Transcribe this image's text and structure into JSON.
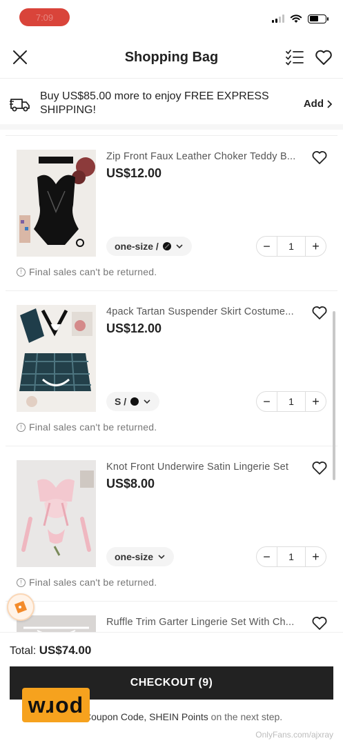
{
  "status_bar": {
    "recording_label": "7:09",
    "battery_level": 0.55
  },
  "header": {
    "title": "Shopping Bag"
  },
  "shipping": {
    "text": "Buy US$85.00 more to enjoy FREE EXPRESS SHIPPING!",
    "action": "Add"
  },
  "items": [
    {
      "title": "Zip Front Faux Leather Choker Teddy B...",
      "price": "US$12.00",
      "variant": "one-size /",
      "variant_swatch": true,
      "qty": "1",
      "note": "Final sales can't be returned."
    },
    {
      "title": "4pack Tartan Suspender Skirt Costume...",
      "price": "US$12.00",
      "variant": "S /",
      "variant_swatch": true,
      "qty": "1",
      "note": "Final sales can't be returned."
    },
    {
      "title": "Knot Front Underwire Satin Lingerie Set",
      "price": "US$8.00",
      "variant": "one-size",
      "variant_swatch": false,
      "qty": "1",
      "note": "Final sales can't be returned."
    },
    {
      "title": "Ruffle Trim Garter Lingerie Set With Ch...",
      "price": "",
      "variant": "",
      "variant_swatch": false,
      "qty": "",
      "note": ""
    }
  ],
  "footer": {
    "total_label": "Total:",
    "total_amount": "US$74.00",
    "checkout_label": "CHECKOUT (9)",
    "hint_prefix": "Coupon Code, SHEIN Points",
    "hint_suffix": " on the next step."
  },
  "overlay": {
    "logo_text": "wɹod",
    "watermark": "OnlyFans.com/ajxray"
  },
  "colors": {
    "rec_red": "#d9443a",
    "checkout_bg": "#222222",
    "logo_orange": "#f6a21e"
  }
}
